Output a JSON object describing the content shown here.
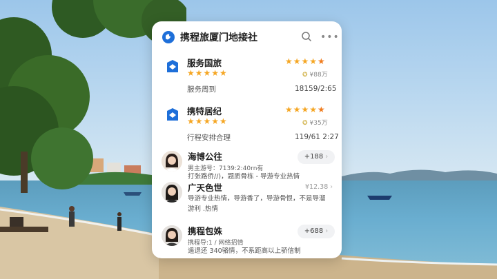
{
  "app": {
    "title": "携程旅厦门地接社",
    "search_icon": "search-icon",
    "more_icon": "more-icon"
  },
  "services": [
    {
      "name": "服务国旅",
      "left_stars": "★★★★★",
      "subtitle": "服务周到",
      "right_stars": "★★★★",
      "right_star_last": "★",
      "badge": "¥88万",
      "value": "18159/2:65"
    },
    {
      "name": "携特居纪",
      "left_stars": "★★★★★",
      "subtitle": "行程安排合理",
      "right_stars": "★★★★",
      "right_star_last": "★",
      "badge": "¥35万",
      "value": "119/61 2:27"
    }
  ],
  "guides": [
    {
      "name": "海博公往",
      "meta": "男主游号：7139:2:40rn有",
      "desc": "打张路侨//)，题质骨栋 - 导游专业热情",
      "pill": "+188",
      "chevron": "›"
    },
    {
      "name": "广天色世",
      "price": "¥12.38",
      "chevron": "›",
      "desc": "导游专业热情，导游香了，导游骨恨，不是导溜游利 .热情"
    },
    {
      "name": "携程包姝",
      "meta": "携程导:1 / 网络招情",
      "desc": "遥退还 340骆情，不系距高以上骄信制",
      "pill": "+688",
      "chevron": "›"
    }
  ],
  "colors": {
    "star": "#f5a623",
    "star_last": "#f07c1e",
    "brand_blue": "#1e6fd9"
  }
}
